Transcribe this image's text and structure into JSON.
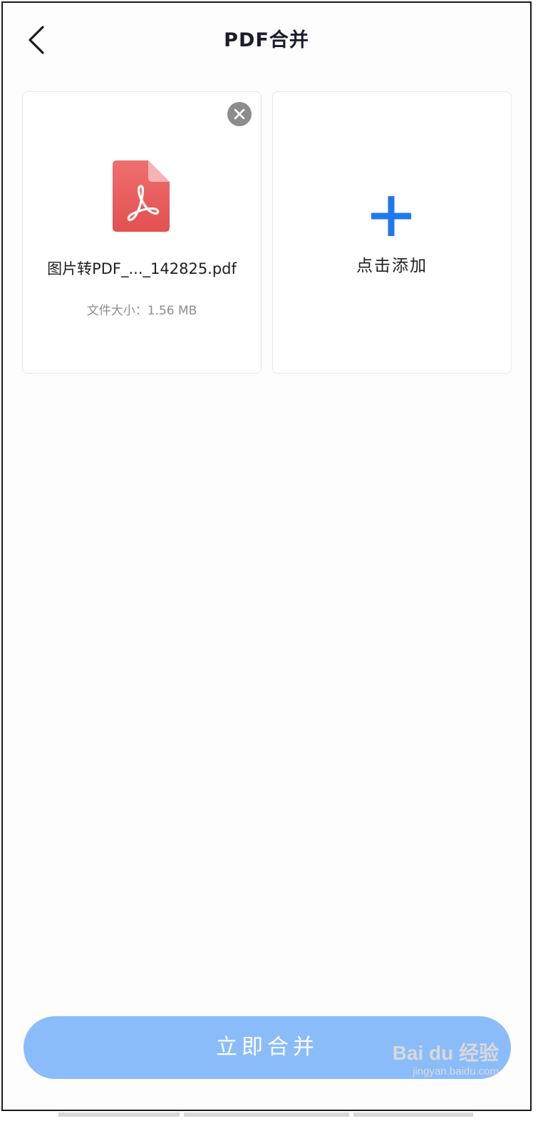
{
  "header": {
    "title": "PDF合并",
    "back_icon": "chevron-left-icon"
  },
  "file_card": {
    "remove_icon": "close-icon",
    "file_icon": "pdf-file-icon",
    "file_name": "图片转PDF_..._142825.pdf",
    "size_label": "文件大小：",
    "size_value": "1.56 MB"
  },
  "add_card": {
    "icon": "plus-icon",
    "label": "点击添加"
  },
  "footer": {
    "merge_button_label": "立即合并"
  },
  "watermark": {
    "brand": "Bai du 经验",
    "url": "jingyan.baidu.com"
  },
  "colors": {
    "accent_blue": "#1e78f0",
    "button_blue": "#8abcfa",
    "pdf_red": "#ea5b5b",
    "remove_gray": "#8c8c8c"
  }
}
